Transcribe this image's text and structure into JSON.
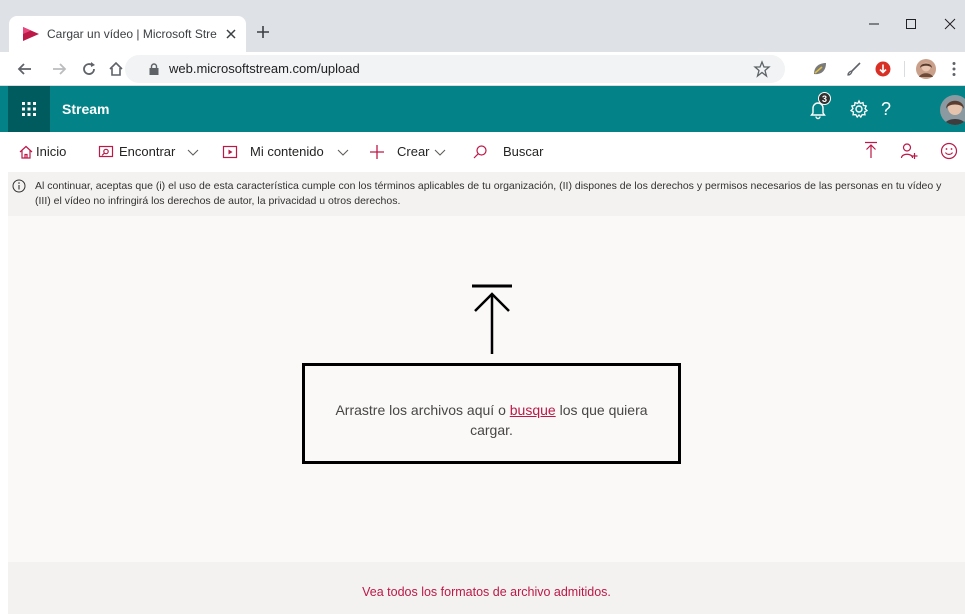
{
  "browser": {
    "tab_title": "Cargar un vídeo | Microsoft Strea",
    "url": "web.microsoftstream.com/upload",
    "icons": [
      "stream-favicon-icon",
      "close-tab-icon",
      "new-tab-icon",
      "minimize-icon",
      "maximize-icon",
      "close-window-icon",
      "back-icon",
      "forward-icon",
      "reload-icon",
      "home-icon",
      "lock-icon",
      "bookmark-star-icon",
      "extension-icons"
    ]
  },
  "appbar": {
    "app_name": "Stream",
    "notification_count": "3",
    "help_label": "?"
  },
  "nav": {
    "home": "Inicio",
    "discover": "Encontrar",
    "my_content": "Mi contenido",
    "create": "Crear",
    "search": "Buscar"
  },
  "notice": {
    "text": "Al continuar, aceptas que (i) el uso de esta característica cumple con los términos aplicables de tu organización, (II) dispones de los derechos y permisos necesarios de las personas en tu vídeo y (III) el vídeo no infringirá los derechos de autor, la privacidad u otros derechos."
  },
  "upload": {
    "text_before": "Arrastre los archivos aquí o ",
    "link": "busque",
    "text_after": " los que quiera cargar."
  },
  "footer": {
    "formats_link": "Vea todos los formatos de archivo admitidos."
  },
  "colors": {
    "app_bar": "#038387",
    "waffle_bg": "#005b5e",
    "accent_link": "#bc1948",
    "tab_strip": "#dee1e6",
    "page_bg": "#faf9f8"
  }
}
